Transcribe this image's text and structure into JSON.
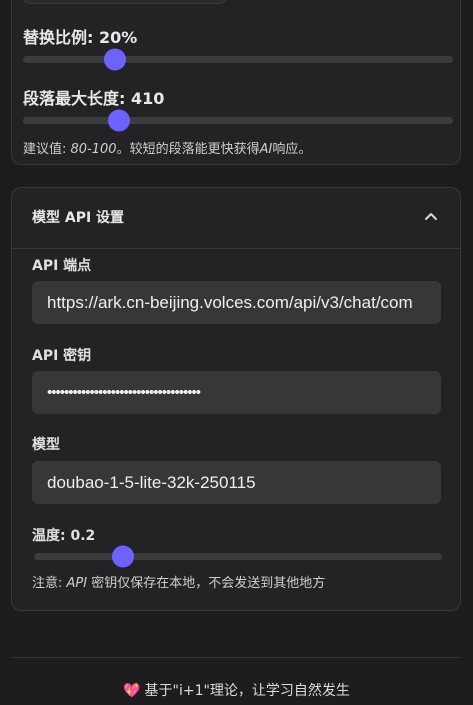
{
  "replacement": {
    "label": "替换比例: 20%",
    "value_percent": 20
  },
  "paragraph_length": {
    "label": "段落最大长度: 410",
    "value": 410
  },
  "hint": {
    "prefix": "建议值: ",
    "range": "80-100",
    "middle": "。较短的段落能更快获得",
    "ai": "AI",
    "suffix": "响应。"
  },
  "api_section": {
    "title": "模型 API 设置",
    "endpoint_label": "API 端点",
    "endpoint_value": "https://ark.cn-beijing.volces.com/api/v3/chat/com",
    "key_label": "API 密钥",
    "key_value": "••••••••••••••••••••••••••••••••••••",
    "model_label": "模型",
    "model_value": "doubao-1-5-lite-32k-250115",
    "temperature_label": "温度: 0.2",
    "temperature_value": 0.2,
    "note_prefix": "注意: ",
    "note_api": "API",
    "note_suffix": " 密钥仅保存在本地，不会发送到其他地方"
  },
  "footer": {
    "text": "基于\"i+1\"理论，让学习自然发生"
  },
  "colors": {
    "accent": "#6c63ff",
    "background": "#1d1d1f",
    "card": "#232325"
  }
}
